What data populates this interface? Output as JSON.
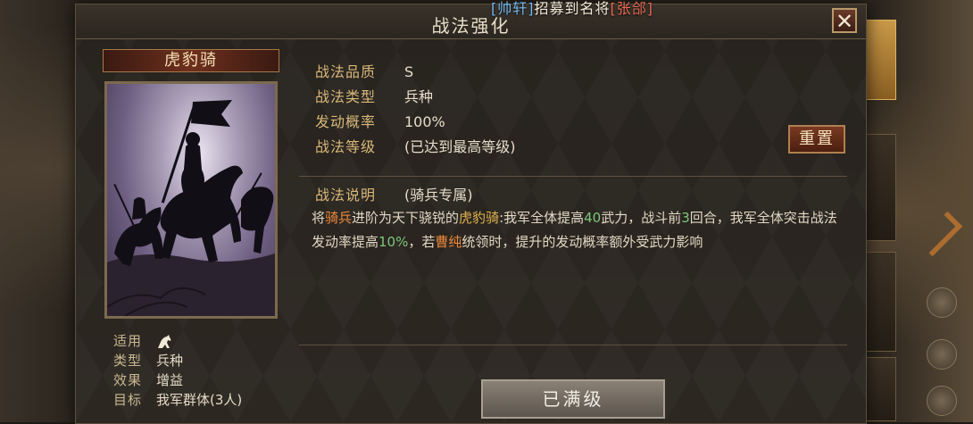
{
  "notice": {
    "player": "[帅轩]",
    "middle": "招募到名将",
    "general": "[张郃]"
  },
  "dialog": {
    "title": "战法强化",
    "close_icon": "close-icon"
  },
  "tactic": {
    "name": "虎豹骑",
    "card_icon": "cavalry-banner-art",
    "attributes": [
      {
        "label": "适用",
        "value": "",
        "icon": "cavalry-horse-icon"
      },
      {
        "label": "类型",
        "value": "兵种"
      },
      {
        "label": "效果",
        "value": "增益"
      },
      {
        "label": "目标",
        "value": "我军群体(3人)"
      }
    ],
    "properties": [
      {
        "label": "战法品质",
        "value": "S"
      },
      {
        "label": "战法类型",
        "value": "兵种"
      },
      {
        "label": "发动概率",
        "value": "100%"
      },
      {
        "label": "战法等级",
        "value": "(已达到最高等级)"
      }
    ],
    "reset_label": "重置",
    "description": {
      "label": "战法说明",
      "tag": "(骑兵专属)",
      "parts": [
        {
          "text": "将",
          "style": ""
        },
        {
          "text": "骑兵",
          "style": "orange"
        },
        {
          "text": "进阶为天下骁锐的",
          "style": ""
        },
        {
          "text": "虎豹骑",
          "style": "gold"
        },
        {
          "text": ":我军全体提高",
          "style": ""
        },
        {
          "text": "40",
          "style": "green"
        },
        {
          "text": "武力，战斗前",
          "style": ""
        },
        {
          "text": "3",
          "style": "green"
        },
        {
          "text": "回合，我军全体突击战法发动率提高",
          "style": ""
        },
        {
          "text": "10%",
          "style": "green"
        },
        {
          "text": "，若",
          "style": ""
        },
        {
          "text": "曹纯",
          "style": "orange"
        },
        {
          "text": "统领时，提升的发动概率额外受武力影响",
          "style": ""
        }
      ]
    },
    "max_level_label": "已满级"
  },
  "colors": {
    "accent_gold": "#d8b87a",
    "highlight_orange": "#f08a3b",
    "highlight_green": "#7dc77a"
  }
}
